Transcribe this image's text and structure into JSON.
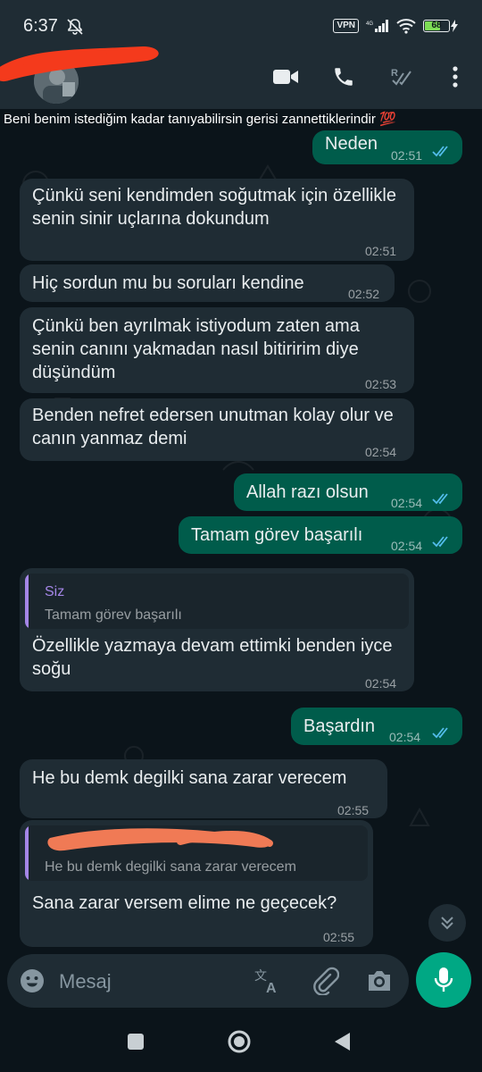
{
  "status_bar": {
    "time": "6:37",
    "vpn": "VPN",
    "battery": "68",
    "battery_level": 0.68
  },
  "header": {
    "icons": [
      "video-call-icon",
      "voice-call-icon",
      "read-receipt-icon",
      "more-options-icon"
    ]
  },
  "subtitle": "Beni benim istediğim kadar tanıyabilirsin gerisi  zannettiklerindir 💯",
  "messages": [
    {
      "dir": "out",
      "text": "Neden",
      "time": "02:51"
    },
    {
      "dir": "in",
      "text": "Çünkü seni kendimden soğutmak için özellikle senin sinir uçlarına dokundum",
      "time": "02:51"
    },
    {
      "dir": "in",
      "text": "Hiç sordun mu bu soruları kendine",
      "time": "02:52"
    },
    {
      "dir": "in",
      "text": "Çünkü ben ayrılmak istiyodum zaten ama senin canını yakmadan nasıl bitiririm diye düşündüm",
      "time": "02:53"
    },
    {
      "dir": "in",
      "text": "Benden nefret edersen unutman kolay olur ve canın yanmaz demi",
      "time": "02:54"
    },
    {
      "dir": "out",
      "text": "Allah razı olsun",
      "time": "02:54"
    },
    {
      "dir": "out",
      "text": "Tamam görev başarılı",
      "time": "02:54"
    },
    {
      "dir": "in",
      "quote_author": "Siz",
      "quote_text": "Tamam görev başarılı",
      "text": "Özellikle yazmaya devam ettimki benden iyce soğu",
      "time": "02:54"
    },
    {
      "dir": "out",
      "text": "Başardın",
      "time": "02:54"
    },
    {
      "dir": "in",
      "text": "He bu demk degilki sana zarar verecem",
      "time": "02:55"
    },
    {
      "dir": "in",
      "quote_text": "He bu demk degilki sana zarar verecem",
      "text": "Sana zarar versem elime ne geçecek?",
      "time": "02:55"
    }
  ],
  "input": {
    "placeholder": "Mesaj"
  },
  "colors": {
    "incoming": "#1f2c34",
    "outgoing": "#005c4b",
    "accent": "#00a884",
    "quote_bar": "#a486e7",
    "ticks": "#53bdeb"
  }
}
